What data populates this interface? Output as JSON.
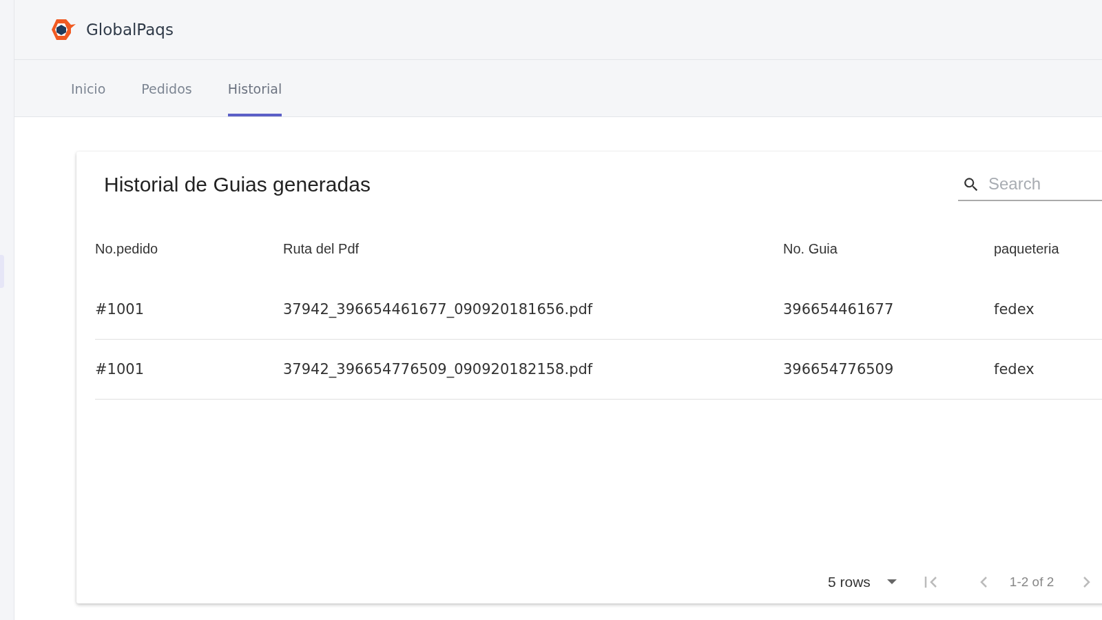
{
  "brand": {
    "name": "GlobalPaqs"
  },
  "tabs": [
    {
      "label": "Inicio",
      "selected": false
    },
    {
      "label": "Pedidos",
      "selected": false
    },
    {
      "label": "Historial",
      "selected": true
    }
  ],
  "card": {
    "title": "Historial de Guias generadas",
    "search": {
      "placeholder": "Search"
    }
  },
  "table": {
    "columns": [
      "No.pedido",
      "Ruta del Pdf",
      "No. Guia",
      "paqueteria"
    ],
    "rows": [
      [
        "#1001",
        "37942_396654461677_090920181656.pdf",
        "396654461677",
        "fedex"
      ],
      [
        "#1001",
        "37942_396654776509_090920182158.pdf",
        "396654776509",
        "fedex"
      ]
    ]
  },
  "pagination": {
    "rows_per_page": "5 rows",
    "range": "1-2 of 2"
  }
}
